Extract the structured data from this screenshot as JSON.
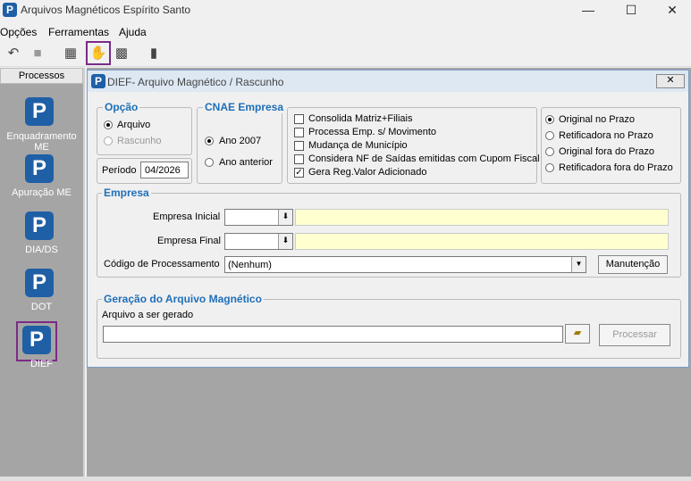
{
  "window": {
    "title": "Arquivos Magnéticos Espírito Santo",
    "minimize": "—",
    "maximize": "☐",
    "close": "✕"
  },
  "menu": [
    "Opções",
    "Ferramentas",
    "Ajuda"
  ],
  "toolbar": [
    {
      "icon": "undo-icon",
      "glyph": "↶"
    },
    {
      "icon": "stop-icon",
      "glyph": "■"
    },
    {
      "icon": "print-icon",
      "glyph": "▦"
    },
    {
      "icon": "handshake-icon",
      "glyph": "✋"
    },
    {
      "icon": "stamp-icon",
      "glyph": "▩"
    },
    {
      "icon": "exit-icon",
      "glyph": "▮"
    }
  ],
  "sidebar": {
    "header": "Processos",
    "items": [
      "Enquadramento ME",
      "Apuração ME",
      "DIA/DS",
      "DOT",
      "DIEF"
    ],
    "icon_letter": "P",
    "selected": "DIEF"
  },
  "dialog": {
    "title": "DIEF- Arquivo Magnético / Rascunho",
    "close": "✕",
    "opcao": {
      "legend": "Opção",
      "options": [
        "Arquivo",
        "Rascunho"
      ],
      "selected": "Arquivo",
      "disabled": [
        "Rascunho"
      ]
    },
    "periodo": {
      "label": "Período",
      "value": "04/2026"
    },
    "cnae": {
      "legend": "CNAE Empresa",
      "options": [
        "Ano 2007",
        "Ano anterior"
      ],
      "selected": "Ano 2007"
    },
    "checks": [
      {
        "label": "Consolida Matriz+Filiais",
        "checked": false
      },
      {
        "label": "Processa Emp. s/ Movimento",
        "checked": false
      },
      {
        "label": "Mudança de Município",
        "checked": false
      },
      {
        "label": "Considera NF de Saídas emitidas com Cupom Fiscal",
        "checked": false
      },
      {
        "label": "Gera Reg.Valor Adicionado",
        "checked": true
      }
    ],
    "prazo": {
      "options": [
        "Original no Prazo",
        "Retificadora no Prazo",
        "Original fora do Prazo",
        "Retificadora fora do Prazo"
      ],
      "selected": "Original no Prazo"
    },
    "empresa": {
      "legend": "Empresa",
      "inicial_label": "Empresa Inicial",
      "final_label": "Empresa Final",
      "codigo_label": "Código de Processamento",
      "codigo_value": "(Nenhum)",
      "manutencao": "Manutenção"
    },
    "geracao": {
      "legend": "Geração do Arquivo Magnético",
      "arquivo_label": "Arquivo a ser gerado",
      "arquivo_value": "",
      "processar": "Processar"
    }
  },
  "colors": {
    "accent": "#1f6fb8",
    "highlight": "#7b2a86",
    "yellow": "#ffffd0"
  }
}
